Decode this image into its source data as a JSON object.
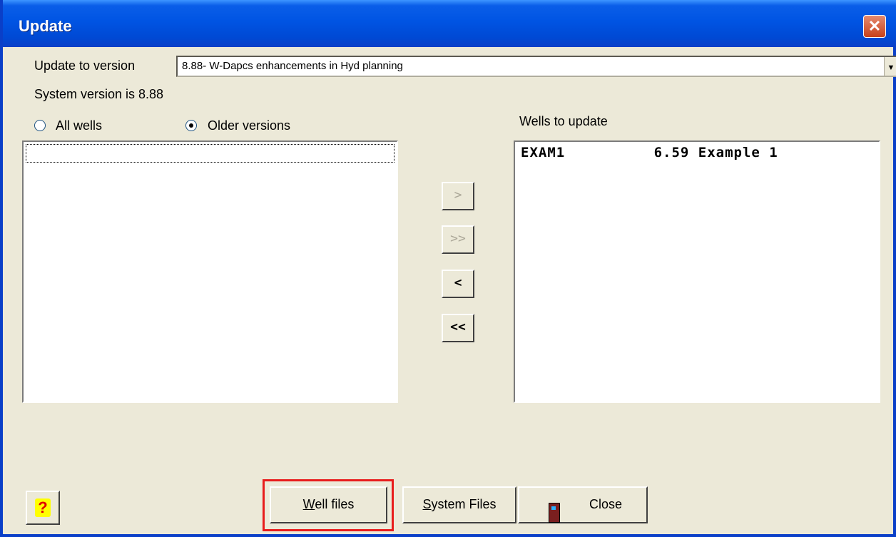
{
  "window": {
    "title": "Update",
    "close_glyph": "✕"
  },
  "update_to": {
    "label": "Update to version",
    "value": "8.88-  W-Dapcs enhancements in Hyd planning",
    "dropdown_glyph": "▼"
  },
  "system_version": "System version is 8.88",
  "filter": {
    "all_wells": {
      "label": "All wells",
      "selected": false
    },
    "older_versions": {
      "label": "Older versions",
      "selected": true
    }
  },
  "wells_to_update": {
    "label": "Wells to update",
    "items": [
      {
        "text": "EXAM1          6.59 Example 1"
      }
    ]
  },
  "move_buttons": {
    "add_one": ">",
    "add_all": ">>",
    "remove_one": "<",
    "remove_all": "<<"
  },
  "help_glyph": "?",
  "buttons": {
    "well_files": {
      "mnemonic": "W",
      "rest": "ell files"
    },
    "system_files": {
      "mnemonic": "S",
      "rest": "ystem Files"
    },
    "close": "Close"
  },
  "icons": {
    "help": "help-icon",
    "close": "door-exit-icon"
  },
  "colors": {
    "titlebar": "#0054e3",
    "highlight": "#e81c1c",
    "face": "#ece9d8"
  }
}
